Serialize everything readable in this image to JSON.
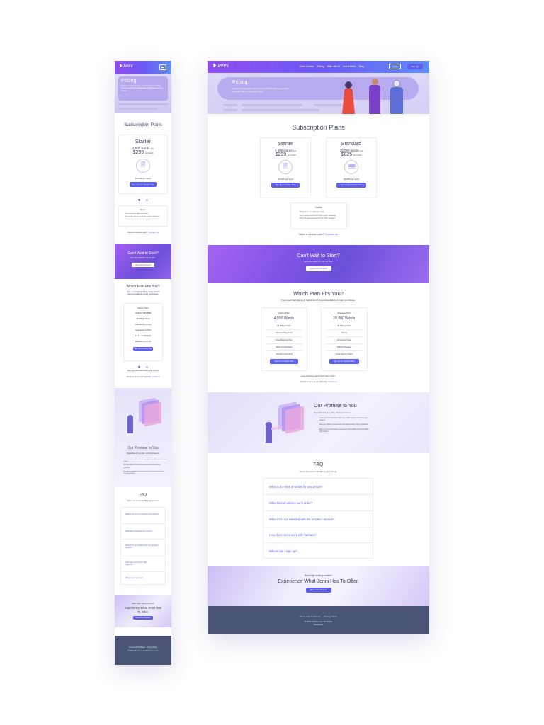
{
  "brand": {
    "logo_text": "Jenni",
    "accent": "#5d5ef0",
    "purple": "#8e4df0",
    "footer_bg": "#4a5576"
  },
  "nav": {
    "links": [
      "Order Content",
      "Pricing",
      "Write with AI",
      "How it Works",
      "Blog"
    ],
    "login": "Login",
    "signup": "Sign Up",
    "menu_icon": "hamburger-icon"
  },
  "hero": {
    "title": "Pricing",
    "subtitle": "Looking for high quality content? Look no further. Jenni is ready with a affordable plans that meet your needs."
  },
  "plans_section": {
    "title": "Subscription Plans",
    "plans": [
      {
        "name": "Starter",
        "words": "4,500 words",
        "words_suffix": "/mo",
        "price": "$299",
        "price_suffix": "per month",
        "per_word": "$0.066",
        "per_word_suffix": "per word",
        "icon": "document-icon",
        "cta": "Sign Up For Starter Plan"
      },
      {
        "name": "Standard",
        "words": "15,000 words",
        "words_suffix": "/mo",
        "price": "$825",
        "price_suffix": "per month",
        "per_word": "$0.055",
        "per_word_suffix": "per word",
        "icon": "documents-icon",
        "cta": "Sign Up For Standard Plan"
      }
    ],
    "notes_title": "Notes",
    "notes": [
      "Prices shown are billed per month.",
      "Word credits roll over up to one month's allowance.",
      "Payment processed securely via online checkout."
    ],
    "custom_q": "Need a custom plan?",
    "custom_link": "Contact us"
  },
  "cta_banner": {
    "title": "Can't Wait to Start?",
    "subtitle": "We Can't Wait For You To Join.",
    "button": "Make A First Request"
  },
  "fit": {
    "title": "Which Plan Fits You?",
    "subtitle": "If you need help deciding, here's Jenni's recommendations to help you choose.",
    "plans": [
      {
        "label": "Starter Plan",
        "words": "4,500 Words",
        "rows": [
          "$0.066 per Word",
          "Unlimited Blog Posts",
          "Great Beginner Plan",
          "Ideal For Individuals",
          "Website Content Fill"
        ],
        "cta": "Sign Up For Starter Plan"
      },
      {
        "label": "Standard Plan",
        "words": "15,000 Words",
        "rows": [
          "$0.055 per Word",
          "Priority",
          "All Content Types",
          "Multiple Websites",
          "Great Agency Choice"
        ],
        "cta": "Sign Up For Standard Plan"
      }
    ],
    "note1": "Have Questions about which plan is best?",
    "note2": "Just hit us up by email, we'll help.",
    "note2_link": "Contact us"
  },
  "promise": {
    "title": "Our Promise to You",
    "subtitle": "Regardless of your plan, Jenni promises to:",
    "items": [
      "Treat your time and brand with care, deliver quality content for your readers.",
      "Give you options to review and edit articles before they're published.",
      "Earn you the performance you deserve with quality content and SEO optimization."
    ]
  },
  "faq": {
    "title": "FAQ",
    "subtitle": "You've Got questions? We've got answers.",
    "items": [
      "What is the limit of words for one article?",
      "What kind of articles can I order?",
      "What if I'm not satisfied with the articles I receive?",
      "How does Jenni work with humans?",
      "Where can I sign up?"
    ]
  },
  "bottom_cta": {
    "kicker": "Want high ranking content?",
    "title": "Experience What Jenni Has To Offer.",
    "button": "Make A First Request"
  },
  "footer": {
    "links": [
      "Terms and Conditions",
      "Privacy Policy"
    ],
    "copyright": "© 2020 Affuzon Inc. All Rights Reserved."
  }
}
